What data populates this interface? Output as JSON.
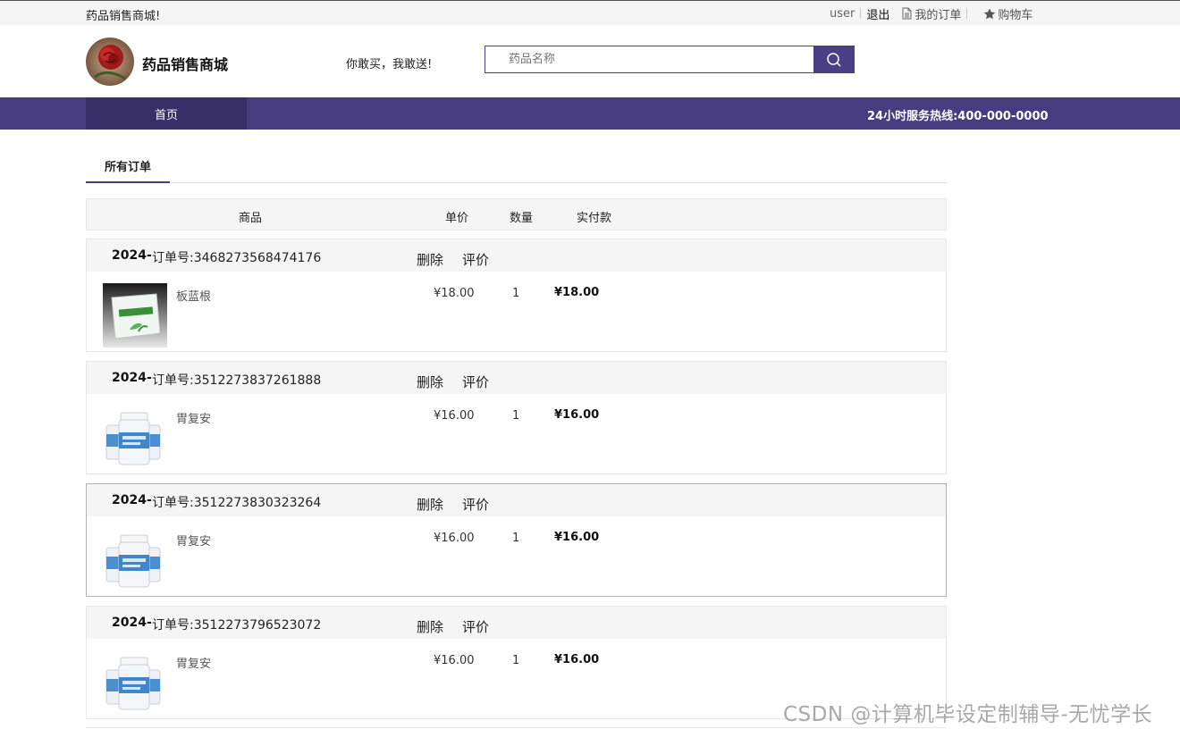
{
  "topbar": {
    "welcome": "药品销售商城!",
    "user": "user",
    "logout": "退出",
    "my_orders": "我的订单",
    "cart": "购物车"
  },
  "header": {
    "site_name": "药品销售商城",
    "slogan": "你敢买，我敢送!",
    "search_placeholder": "药品名称"
  },
  "nav": {
    "home": "首页",
    "hotline": "24小时服务热线:400-000-0000"
  },
  "tabs": {
    "all_orders": "所有订单"
  },
  "table_header": {
    "product": "商品",
    "unit_price": "单价",
    "quantity": "数量",
    "paid": "实付款"
  },
  "actions": {
    "delete": "删除",
    "review": "评价"
  },
  "orders": [
    {
      "year": "2024-",
      "order_no": "订单号:3468273568474176",
      "product": "板蓝根",
      "price": "¥18.00",
      "qty": "1",
      "paid": "¥18.00",
      "image": "granule-sachet"
    },
    {
      "year": "2024-",
      "order_no": "订单号:3512273837261888",
      "product": "胃复安",
      "price": "¥16.00",
      "qty": "1",
      "paid": "¥16.00",
      "image": "pill-bottles"
    },
    {
      "year": "2024-",
      "order_no": "订单号:3512273830323264",
      "product": "胃复安",
      "price": "¥16.00",
      "qty": "1",
      "paid": "¥16.00",
      "image": "pill-bottles"
    },
    {
      "year": "2024-",
      "order_no": "订单号:3512273796523072",
      "product": "胃复安",
      "price": "¥16.00",
      "qty": "1",
      "paid": "¥16.00",
      "image": "pill-bottles"
    }
  ],
  "watermark": "CSDN @计算机毕设定制辅导-无忧学长",
  "colors": {
    "brand": "#473c80",
    "brand_dark": "#382f69"
  }
}
